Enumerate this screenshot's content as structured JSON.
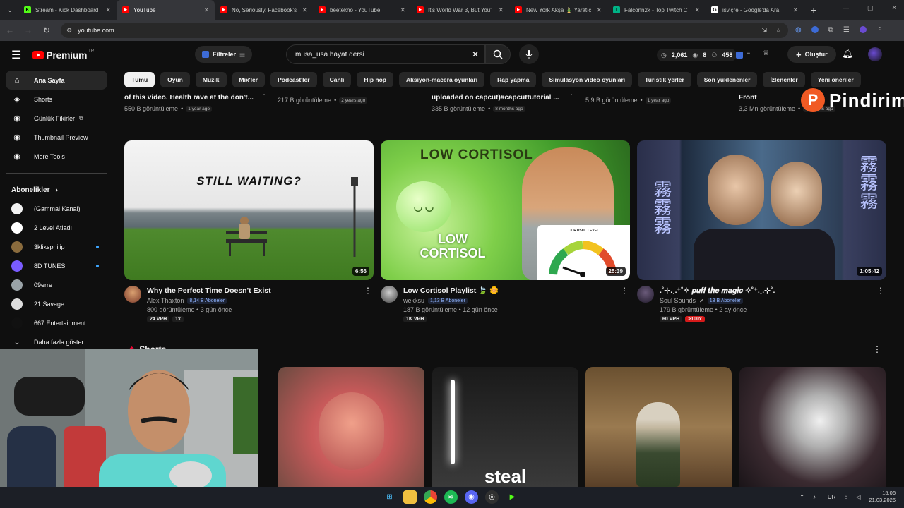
{
  "browser": {
    "tabs": [
      {
        "title": "Stream - Kick Dashboard",
        "color": "#53fc18",
        "glyph": "K",
        "active": false
      },
      {
        "title": "YouTube",
        "color": "#ff0000",
        "glyph": "▶",
        "active": true
      },
      {
        "title": "No, Seriously. Facebook's",
        "color": "#ff0000",
        "glyph": "▶",
        "active": false
      },
      {
        "title": "beetekno - YouTube",
        "color": "#ff0000",
        "glyph": "▶",
        "active": false
      },
      {
        "title": "It's World War 3, But You'",
        "color": "#ff0000",
        "glyph": "▶",
        "active": false
      },
      {
        "title": "New York Akşa 🎍 Yaratıc",
        "color": "#ff0000",
        "glyph": "▶",
        "active": false
      },
      {
        "title": "Falconn2k - Top Twitch C",
        "color": "#00b386",
        "glyph": "T",
        "active": false
      },
      {
        "title": "isviçre - Google'da Ara",
        "color": "#ffffff",
        "glyph": "G",
        "active": false
      }
    ],
    "url": "youtube.com"
  },
  "youtube": {
    "logo_text": "Premium",
    "logo_region": "TR",
    "filters_label": "Filtreler",
    "search_value": "musa_usa hayat dersi",
    "stats": {
      "views": "2,061",
      "eyes": "8",
      "count": "458"
    },
    "create_label": "Oluştur"
  },
  "sidebar": {
    "main": [
      {
        "label": "Ana Sayfa",
        "icon": "home-icon",
        "glyph": "⌂"
      },
      {
        "label": "Shorts",
        "icon": "shorts-icon",
        "glyph": "◈"
      },
      {
        "label": "Günlük Fikirler",
        "icon": "ideas-icon",
        "glyph": "◉"
      },
      {
        "label": "Thumbnail Preview",
        "icon": "thumbnail-icon",
        "glyph": "◉"
      },
      {
        "label": "More Tools",
        "icon": "tools-icon",
        "glyph": "◉"
      }
    ],
    "subs_title": "Abonelikler",
    "subs": [
      {
        "label": "(Gammal Kanal)",
        "color": "#f2f2f2",
        "live": false
      },
      {
        "label": "2 Level Atladı",
        "color": "#ffffff",
        "live": false
      },
      {
        "label": "3kliksphilip",
        "color": "#8a6b3d",
        "live": true
      },
      {
        "label": "8D TUNES",
        "color": "#7a5cff",
        "live": true
      },
      {
        "label": "09erre",
        "color": "#9aa3a8",
        "live": false
      },
      {
        "label": "21 Savage",
        "color": "#dddddd",
        "live": false
      },
      {
        "label": "667 Entertainment",
        "color": "#111111",
        "live": false
      }
    ],
    "show_more": "Daha fazla göster"
  },
  "chips": [
    "Tümü",
    "Oyun",
    "Müzik",
    "Mix'ler",
    "Podcast'ler",
    "Canlı",
    "Hip hop",
    "Aksiyon-macera oyunları",
    "Rap yapma",
    "Simülasyon video oyunları",
    "Turistik yerler",
    "Son yüklenenler",
    "İzlenenler",
    "Yeni öneriler"
  ],
  "prev_row": [
    {
      "title": "of this video. Health rave at the don't...",
      "views": "550 B görüntüleme",
      "ago": "1 year ago"
    },
    {
      "title": "",
      "views": "217 B görüntüleme",
      "ago": "2 years ago"
    },
    {
      "title": "uploaded on capcut)#capcuttutorial ...",
      "views": "335 B görüntüleme",
      "ago": "8 months ago"
    },
    {
      "title": "",
      "views": "5,9 B görüntüleme",
      "ago": "1 year ago"
    },
    {
      "title": "Front",
      "views": "3,3 Mn görüntüleme",
      "ago": "2 months ago"
    }
  ],
  "videos": [
    {
      "title": "Why the Perfect Time Doesn't Exist",
      "channel": "Alex Thaxton",
      "subs": "8,14 B Aboneler",
      "meta": "800 görüntüleme • 3 gün önce",
      "duration": "6:56",
      "thumb_text": "STILL WAITING?",
      "tags": [
        {
          "text": "24 VPH",
          "red": false
        },
        {
          "text": "1x",
          "red": false
        }
      ]
    },
    {
      "title": "Low Cortisol Playlist 🍃 🌼",
      "channel": "wekksu",
      "subs": "1,13 B Aboneler",
      "meta": "187 B görüntüleme • 12 gün önce",
      "duration": "25:39",
      "thumb_text": "LOW CORTISOL",
      "thumb_text2": "LOW CORTISOL",
      "gauge_label": "CORTISOL LEVEL",
      "tags": [
        {
          "text": "1K VPH",
          "red": false
        }
      ]
    },
    {
      "title": ".˚⊹.˳.⁺˚✧ 𝒑𝒖𝒇𝒇 𝒕𝒉𝒆 𝒎𝒂𝒈𝒊𝒄 ✧˚⁺.˳.⊹˚.",
      "channel": "Soul Sounds",
      "subs": "13 B Aboneler",
      "meta": "179 B görüntüleme • 2 ay önce",
      "duration": "1:05:42",
      "thumb_text": "霧霧霧",
      "tags": [
        {
          "text": "60 VPH",
          "red": false
        },
        {
          "text": ">100x",
          "red": true
        }
      ]
    }
  ],
  "shorts_title": "Shorts",
  "shorts": [
    {
      "caption": "",
      "palette": "#c96060"
    },
    {
      "caption": "steal",
      "palette": "#2a2a2a"
    },
    {
      "caption": "",
      "palette": "#8a6a40"
    },
    {
      "caption": "",
      "palette": "#3a3035"
    }
  ],
  "watermark": {
    "letter": "P",
    "word": "Pindirim"
  },
  "taskbar": {
    "lang": "TUR",
    "time": "15:06",
    "date": "21.03.2026"
  }
}
